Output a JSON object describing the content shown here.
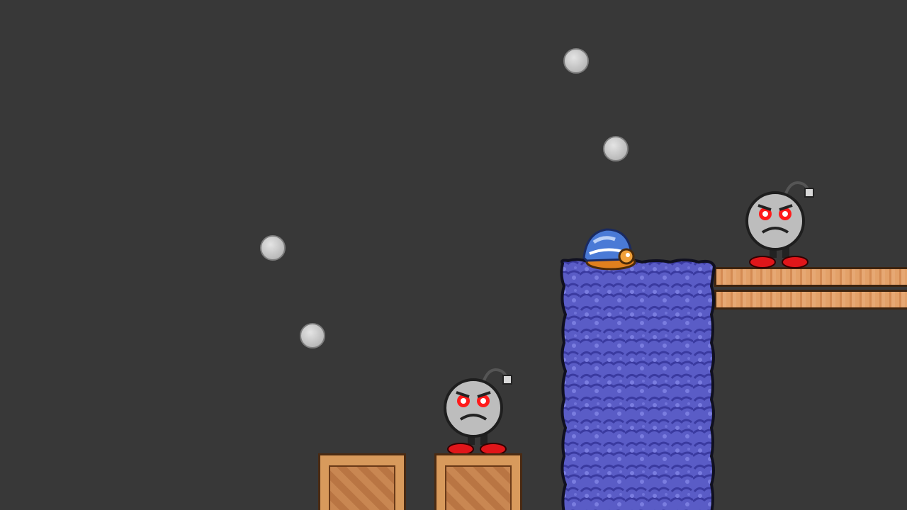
{
  "scene": {
    "background_color": "#383838",
    "coins": [
      {
        "name": "coin-top"
      },
      {
        "name": "coin-upper-right"
      },
      {
        "name": "coin-left-upper"
      },
      {
        "name": "coin-left-lower"
      }
    ],
    "enemies": [
      {
        "name": "bob-omb-ground",
        "type": "bob-omb"
      },
      {
        "name": "bob-omb-platform",
        "type": "bob-omb"
      }
    ],
    "shell": {
      "name": "buzzy-shell",
      "color": "#4a7ad6"
    },
    "waterfall": {
      "color": "#5a5cc6"
    },
    "crates": [
      {
        "name": "crate-left"
      },
      {
        "name": "crate-right"
      }
    ],
    "platform": {
      "name": "wooden-ledge",
      "color": "#e3a169"
    }
  }
}
